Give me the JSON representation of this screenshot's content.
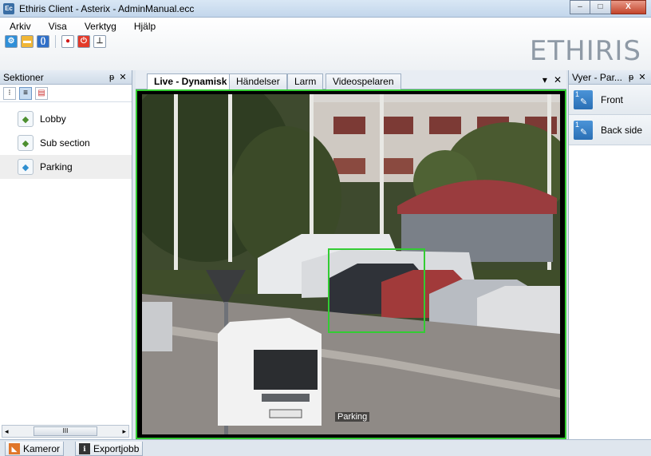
{
  "window": {
    "icon_text": "Ec",
    "title": "Ethiris Client - Asterix - AdminManual.ecc",
    "minimize": "–",
    "maximize": "□",
    "close": "X"
  },
  "menu": [
    "Arkiv",
    "Visa",
    "Verktyg",
    "Hjälp"
  ],
  "toolbar_icons": [
    "settings-icon",
    "folder-icon",
    "bracket-icon",
    "record-icon",
    "power-icon",
    "download-icon"
  ],
  "logo": "ETHIRIS",
  "left_panel": {
    "title": "Sektioner",
    "pin": "ᵽ",
    "close": "✕",
    "sections": [
      {
        "label": "Lobby"
      },
      {
        "label": "Sub section"
      },
      {
        "label": "Parking"
      }
    ],
    "scroll_thumb": "III"
  },
  "tabs": [
    "Live - Dynamisk",
    "Händelser",
    "Larm",
    "Videospelaren"
  ],
  "tab_controls": {
    "menu": "▾",
    "close": "✕"
  },
  "camera": {
    "label": "Parking"
  },
  "right_panel": {
    "title": "Vyer - Par...",
    "pin": "ᵽ",
    "close": "✕",
    "views": [
      {
        "num": "1",
        "label": "Front"
      },
      {
        "num": "1",
        "label": "Back side"
      }
    ]
  },
  "bottom_tabs": [
    {
      "label": "Kameror"
    },
    {
      "label": "Exportjobb"
    }
  ],
  "colors": {
    "selection_box": "#33cc33",
    "view_icon": "#2a6fb5"
  }
}
